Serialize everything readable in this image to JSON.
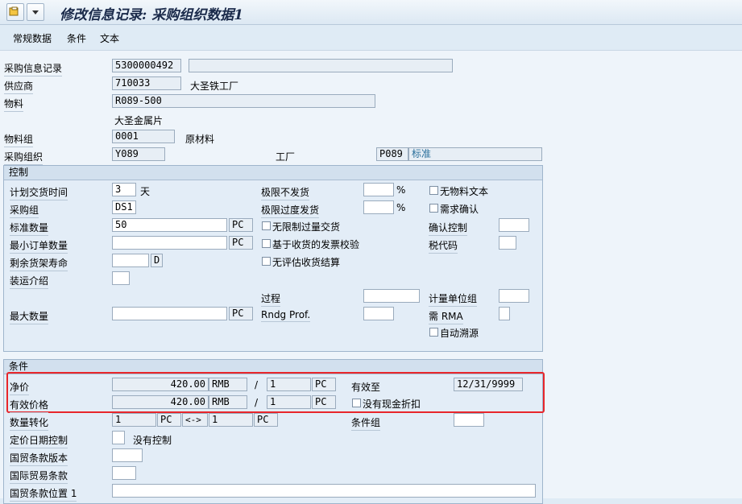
{
  "title": "修改信息记录: 采购组织数据1",
  "menu": [
    "常规数据",
    "条件",
    "文本"
  ],
  "header": {
    "info_record_label": "采购信息记录",
    "info_record_value": "5300000492",
    "vendor_label": "供应商",
    "vendor_value": "710033",
    "vendor_name": "大圣铁工厂",
    "material_label": "物料",
    "material_value": "R089-500",
    "material_desc": "大圣金属片",
    "matgroup_label": "物料组",
    "matgroup_value": "0001",
    "matgroup_desc": "原材料",
    "purch_org_label": "采购组织",
    "purch_org_value": "Y089",
    "plant_label": "工厂",
    "plant_value": "P089",
    "plant_desc": "标准"
  },
  "control": {
    "title": "控制",
    "planned_delivery_label": "计划交货时间",
    "planned_delivery_value": "3",
    "planned_delivery_unit": "天",
    "purch_group_label": "采购组",
    "purch_group_value": "DS1",
    "std_qty_label": "标准数量",
    "std_qty_value": "50",
    "std_qty_unit": "PC",
    "min_qty_label": "最小订单数量",
    "min_qty_unit": "PC",
    "shelf_life_label": "剩余货架寿命",
    "shelf_life_unit": "D",
    "shipping_label": "装运介绍",
    "max_qty_label": "最大数量",
    "max_qty_unit": "PC",
    "underdel_label": "极限不发货",
    "overdel_label": "极限过度发货",
    "pct": "%",
    "unlimited_label": "无限制过量交货",
    "gr_iv_label": "基于收货的发票校验",
    "no_ers_label": "无评估收货结算",
    "procedure_label": "过程",
    "rndg_label": "Rndg Prof.",
    "no_mat_text_label": "无物料文本",
    "ack_req_label": "需求确认",
    "conf_ctrl_label": "确认控制",
    "tax_code_label": "税代码",
    "uom_group_label": "计量单位组",
    "rma_label": "需 RMA",
    "auto_source_label": "自动溯源"
  },
  "conditions": {
    "title": "条件",
    "net_price_label": "净价",
    "net_price_value": "420.00",
    "currency": "RMB",
    "per_sep": "/",
    "per_qty": "1",
    "per_unit": "PC",
    "valid_to_label": "有效至",
    "valid_to_value": "12/31/9999",
    "eff_price_label": "有效价格",
    "eff_price_value": "420.00",
    "no_cash_disc_label": "没有现金折扣",
    "qty_conv_label": "数量转化",
    "conv_left_qty": "1",
    "conv_left_unit": "PC",
    "conv_arrow": "<->",
    "conv_right_qty": "1",
    "conv_right_unit": "PC",
    "cond_group_label": "条件组",
    "pricing_date_label": "定价日期控制",
    "pricing_date_desc": "没有控制",
    "incoterms_version_label": "国贸条款版本",
    "incoterms_label": "国际贸易条款",
    "incoterms_loc_label": "国贸条款位置 1"
  }
}
